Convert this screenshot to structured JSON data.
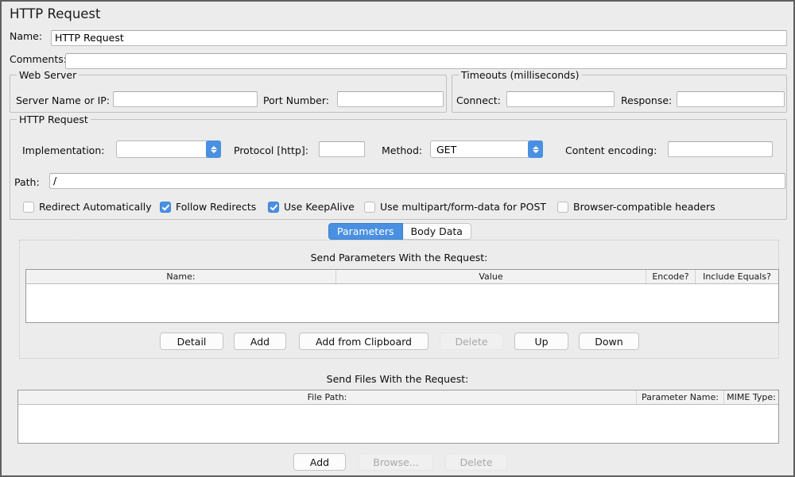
{
  "window": {
    "title": "HTTP Request"
  },
  "name_row": {
    "label": "Name:",
    "value": "HTTP Request"
  },
  "comments_row": {
    "label": "Comments:",
    "value": ""
  },
  "web_server": {
    "title": "Web Server",
    "server_label": "Server Name or IP:",
    "server_value": "",
    "port_label": "Port Number:",
    "port_value": ""
  },
  "timeouts": {
    "title": "Timeouts (milliseconds)",
    "connect_label": "Connect:",
    "connect_value": "",
    "response_label": "Response:",
    "response_value": ""
  },
  "http_request": {
    "title": "HTTP Request",
    "implementation_label": "Implementation:",
    "implementation_value": "",
    "protocol_label": "Protocol [http]:",
    "protocol_value": "",
    "method_label": "Method:",
    "method_value": "GET",
    "content_encoding_label": "Content encoding:",
    "content_encoding_value": "",
    "path_label": "Path:",
    "path_value": "/",
    "checkboxes": [
      {
        "label": "Redirect Automatically",
        "checked": false
      },
      {
        "label": "Follow Redirects",
        "checked": true
      },
      {
        "label": "Use KeepAlive",
        "checked": true
      },
      {
        "label": "Use multipart/form-data for POST",
        "checked": false
      },
      {
        "label": "Browser-compatible headers",
        "checked": false
      }
    ]
  },
  "tabs": [
    {
      "label": "Parameters",
      "active": true
    },
    {
      "label": "Body Data",
      "active": false
    }
  ],
  "parameters_panel": {
    "caption": "Send Parameters With the Request:",
    "columns": [
      "Name:",
      "Value",
      "Encode?",
      "Include Equals?"
    ],
    "rows": [],
    "buttons": [
      {
        "label": "Detail",
        "enabled": true
      },
      {
        "label": "Add",
        "enabled": true
      },
      {
        "label": "Add from Clipboard",
        "enabled": true
      },
      {
        "label": "Delete",
        "enabled": false
      },
      {
        "label": "Up",
        "enabled": true
      },
      {
        "label": "Down",
        "enabled": true
      }
    ]
  },
  "files_panel": {
    "caption": "Send Files With the Request:",
    "columns": [
      "File Path:",
      "Parameter Name:",
      "MIME Type:"
    ],
    "rows": [],
    "buttons": [
      {
        "label": "Add",
        "enabled": true
      },
      {
        "label": "Browse...",
        "enabled": false
      },
      {
        "label": "Delete",
        "enabled": false
      }
    ]
  },
  "colors": {
    "accent": "#4a90e2",
    "window_bg": "#ececec",
    "field_bg": "#ffffff",
    "disabled_text": "#a8a8a8"
  }
}
